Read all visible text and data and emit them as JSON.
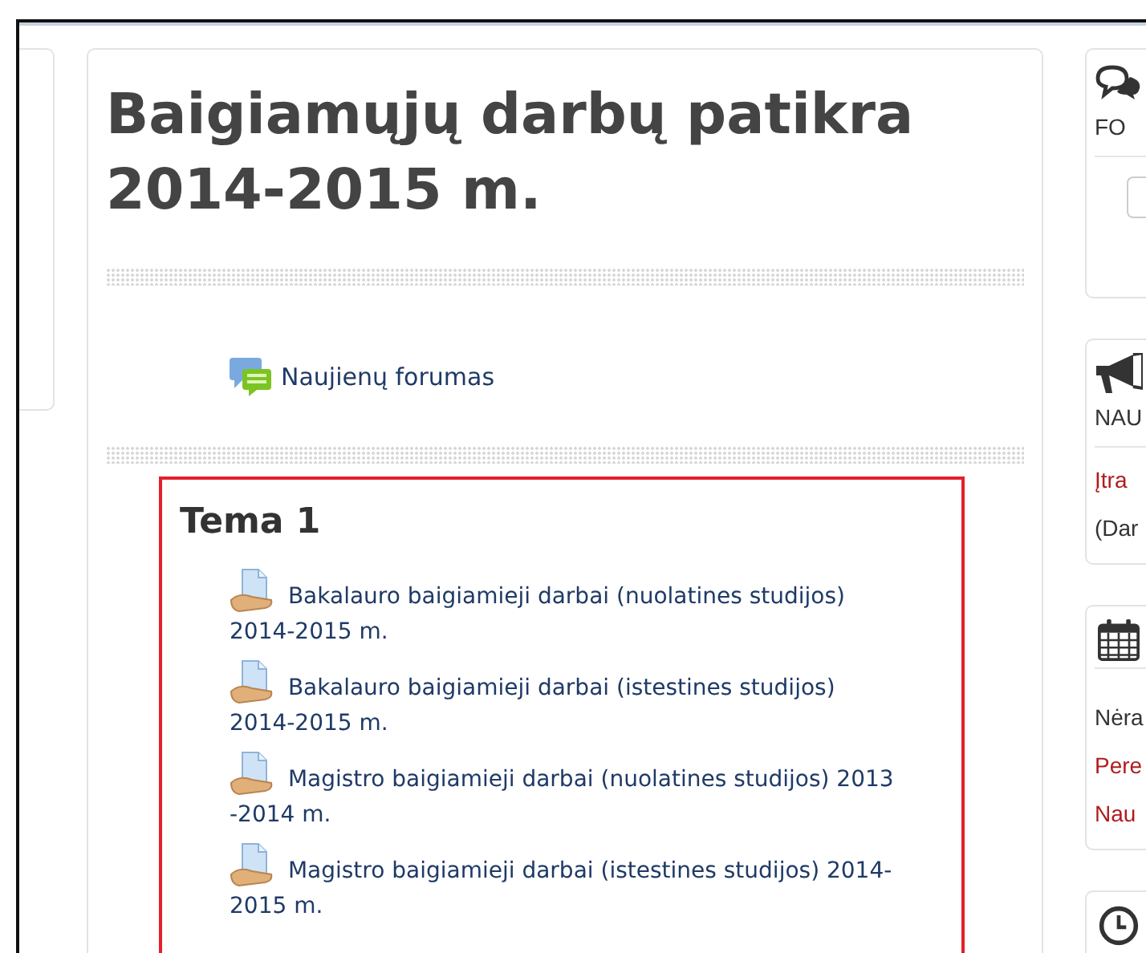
{
  "course": {
    "title": "Baigiamųjų darbų patikra 2014-2015 m.",
    "forum": {
      "label": "Naujienų forumas"
    },
    "section": {
      "title": "Tema 1",
      "highlighted": true,
      "items": [
        {
          "label": "Bakalauro baigiamieji darbai (nuolatines studijos) 2014-2015 m."
        },
        {
          "label": "Bakalauro baigiamieji darbai (istestines studijos) 2014-2015 m."
        },
        {
          "label": "Magistro baigiamieji darbai (nuolatines studijos) 2013 -2014 m."
        },
        {
          "label": "Magistro baigiamieji darbai (istestines studijos) 2014-2015 m."
        }
      ]
    }
  },
  "right_blocks": [
    {
      "kind": "forum",
      "heading": "FO"
    },
    {
      "kind": "news",
      "heading": "NAU",
      "lines": [
        {
          "text": "Įtra",
          "link": true
        },
        {
          "text": "(Dar",
          "link": false
        }
      ]
    },
    {
      "kind": "calendar",
      "lines": [
        {
          "text": "Nėra",
          "link": false
        },
        {
          "text": "Pere",
          "link": true
        },
        {
          "text": "Nau",
          "link": true
        }
      ]
    },
    {
      "kind": "clock"
    }
  ]
}
